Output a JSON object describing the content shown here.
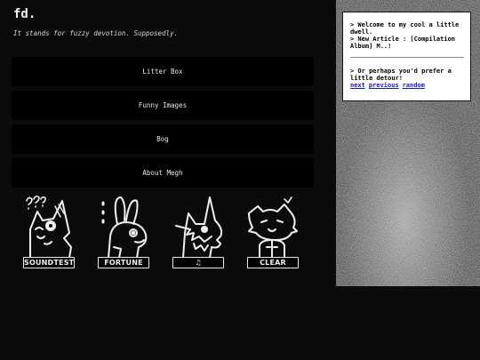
{
  "site": {
    "title": "fd.",
    "tagline": "It stands for fuzzy devotion. Supposedly."
  },
  "nav": [
    {
      "label": "Litter Box"
    },
    {
      "label": "Funny Images"
    },
    {
      "label": "Bog"
    },
    {
      "label": "About Megh"
    }
  ],
  "badges": [
    {
      "caption": "SOUNDTEST",
      "icon": "fox-confused-icon"
    },
    {
      "caption": "FORTUNE",
      "icon": "rabbit-fortune-icon"
    },
    {
      "caption": "♫",
      "icon": "wolf-music-icon"
    },
    {
      "caption": "CLEAR",
      "icon": "cat-clear-icon"
    }
  ],
  "panel": {
    "welcome": "> Welcome to my cool a little dwell.",
    "article": "> New Article : [Compilation Album] M..!",
    "detour": "> Or perhaps you'd prefer a little detour!",
    "links": {
      "next": "next",
      "previous": "previous",
      "random": "random"
    }
  },
  "colors": {
    "background": "#0b0b0b",
    "button": "#000000",
    "link": "#1a1ab8",
    "panel": "#ffffff"
  }
}
